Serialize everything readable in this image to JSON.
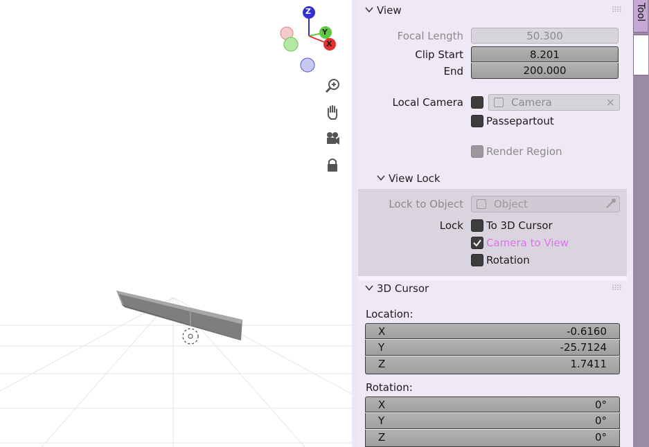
{
  "gizmo": {
    "z": "Z",
    "y": "Y",
    "x": "X"
  },
  "view": {
    "title": "View",
    "focal_length_label": "Focal Length",
    "focal_length_value": "50.300",
    "clip_start_label": "Clip Start",
    "clip_start_value": "8.201",
    "end_label": "End",
    "end_value": "200.000",
    "local_camera_label": "Local Camera",
    "local_camera_value": "Camera",
    "passepartout_label": "Passepartout",
    "render_region_label": "Render Region"
  },
  "view_lock": {
    "title": "View Lock",
    "lock_to_object_label": "Lock to Object",
    "lock_to_object_placeholder": "Object",
    "lock_label": "Lock",
    "to_3d_cursor_label": "To 3D Cursor",
    "camera_to_view_label": "Camera to View",
    "camera_to_view_checked": true,
    "rotation_label": "Rotation"
  },
  "cursor": {
    "title": "3D Cursor",
    "location_label": "Location:",
    "location": [
      {
        "axis": "X",
        "value": "-0.6160"
      },
      {
        "axis": "Y",
        "value": "-25.7124"
      },
      {
        "axis": "Z",
        "value": "1.7411"
      }
    ],
    "rotation_label": "Rotation:",
    "rotation": [
      {
        "axis": "X",
        "value": "0°"
      },
      {
        "axis": "Y",
        "value": "0°"
      },
      {
        "axis": "Z",
        "value": "0°"
      }
    ]
  },
  "tabs": {
    "tool": "Tool"
  },
  "colors": {
    "accent": "#e070f0",
    "x_axis": "#e03030",
    "y_axis": "#60c840",
    "z_axis": "#3030d0"
  }
}
